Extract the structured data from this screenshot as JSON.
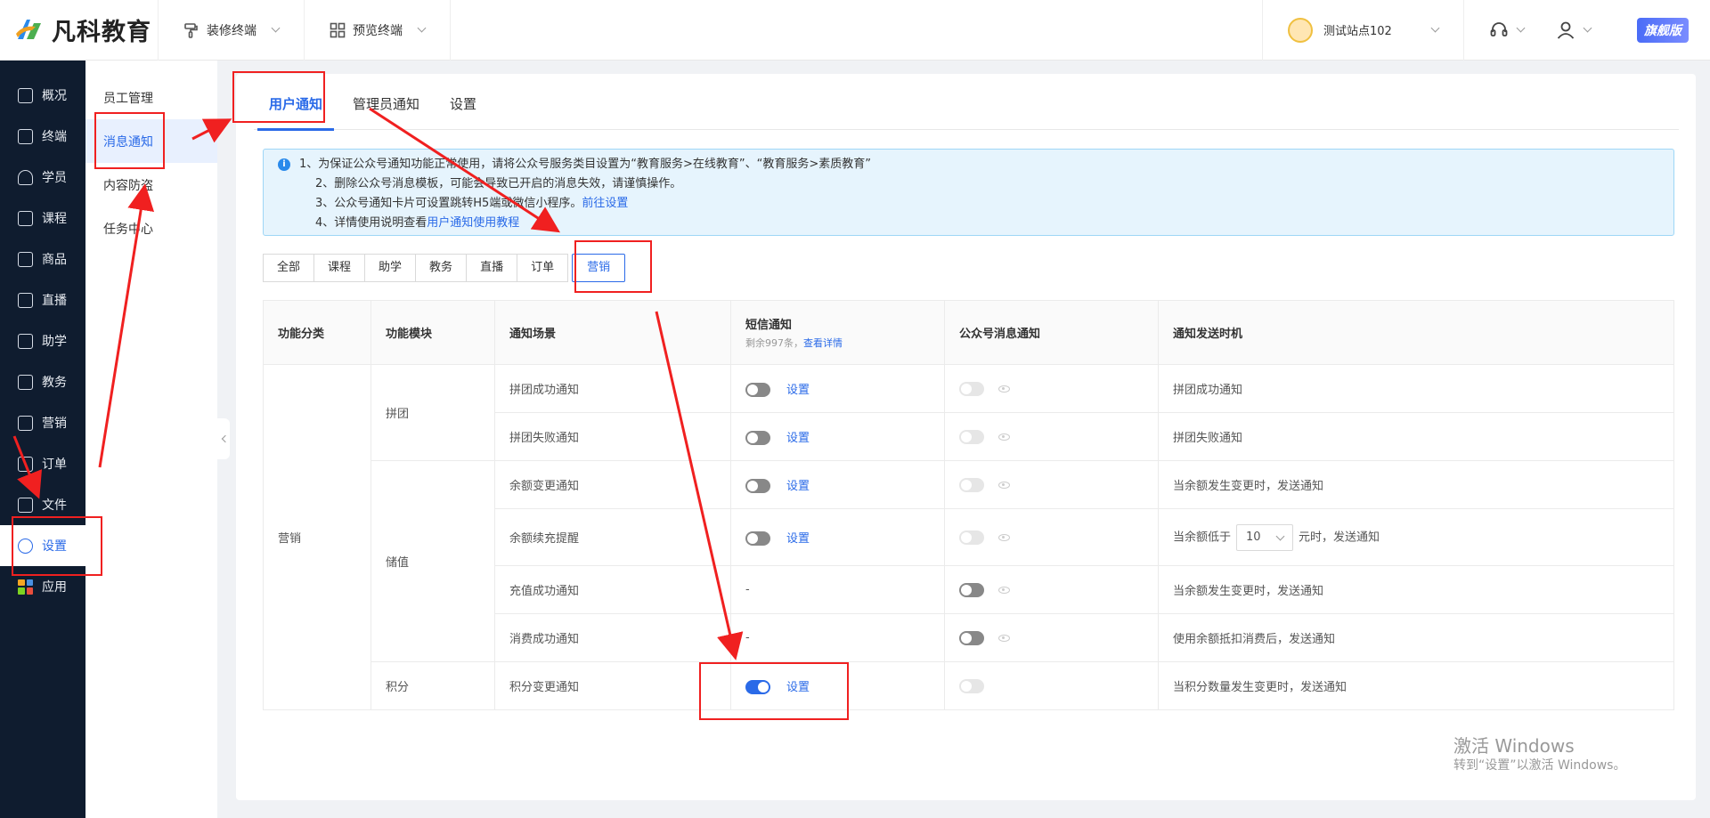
{
  "header": {
    "logo_text": "凡科教育",
    "nav": [
      {
        "label": "装修终端",
        "icon": "paint-roller-icon"
      },
      {
        "label": "预览终端",
        "icon": "grid-icon"
      }
    ],
    "site_name": "测试站点102",
    "edition_badge": "旗舰版"
  },
  "sidebar": {
    "items": [
      {
        "label": "概况",
        "icon": "grid-icon"
      },
      {
        "label": "终端",
        "icon": "store-icon"
      },
      {
        "label": "学员",
        "icon": "users-icon"
      },
      {
        "label": "课程",
        "icon": "course-icon"
      },
      {
        "label": "商品",
        "icon": "goods-icon"
      },
      {
        "label": "直播",
        "icon": "live-icon"
      },
      {
        "label": "助学",
        "icon": "assist-icon"
      },
      {
        "label": "教务",
        "icon": "book-icon"
      },
      {
        "label": "营销",
        "icon": "shop-icon"
      },
      {
        "label": "订单",
        "icon": "order-icon"
      },
      {
        "label": "文件",
        "icon": "folder-icon"
      },
      {
        "label": "设置",
        "icon": "settings-icon",
        "active": true
      },
      {
        "label": "应用",
        "icon": "apps-icon"
      }
    ]
  },
  "subnav": {
    "items": [
      {
        "label": "员工管理"
      },
      {
        "label": "消息通知",
        "active": true
      },
      {
        "label": "内容防盗"
      },
      {
        "label": "任务中心"
      }
    ]
  },
  "tabs": [
    {
      "label": "用户通知",
      "active": true
    },
    {
      "label": "管理员通知"
    },
    {
      "label": "设置"
    }
  ],
  "notice": {
    "line1": "1、为保证公众号通知功能正常使用，请将公众号服务类目设置为“教育服务>在线教育”、“教育服务>素质教育”",
    "line2": "2、删除公众号消息模板，可能会导致已开启的消息失效，请谨慎操作。",
    "line3_text": "3、公众号通知卡片可设置跳转H5端或微信小程序。",
    "line3_link": "前往设置",
    "line4_text": "4、详情使用说明查看",
    "line4_link": "用户通知使用教程"
  },
  "categories": [
    {
      "label": "全部"
    },
    {
      "label": "课程"
    },
    {
      "label": "助学"
    },
    {
      "label": "教务"
    },
    {
      "label": "直播"
    },
    {
      "label": "订单"
    },
    {
      "label": "营销",
      "active": true
    }
  ],
  "table": {
    "headers": {
      "category": "功能分类",
      "module": "功能模块",
      "scene": "通知场景",
      "sms": "短信通知",
      "sms_remaining": "剩余997条，",
      "sms_detail_link": "查看详情",
      "wechat": "公众号消息通知",
      "timing": "通知发送时机"
    },
    "category_value": "营销",
    "modules": {
      "group": "拼团",
      "balance": "储值",
      "points": "积分"
    },
    "setting_label": "设置",
    "dash": "-",
    "rows": [
      {
        "scene": "拼团成功通知",
        "sms": "off",
        "wechat": "disabled",
        "timing": "拼团成功通知"
      },
      {
        "scene": "拼团失败通知",
        "sms": "off",
        "wechat": "disabled",
        "timing": "拼团失败通知"
      },
      {
        "scene": "余额变更通知",
        "sms": "off",
        "wechat": "disabled",
        "timing": "当余额发生变更时，发送通知"
      },
      {
        "scene": "余额续充提醒",
        "sms": "off",
        "wechat": "disabled",
        "timing_prefix": "当余额低于",
        "timing_value": "10",
        "timing_suffix": "元时，发送通知"
      },
      {
        "scene": "充值成功通知",
        "sms": "none",
        "wechat": "off",
        "timing": "当余额发生变更时，发送通知"
      },
      {
        "scene": "消费成功通知",
        "sms": "none",
        "wechat": "off",
        "timing": "使用余额抵扣消费后，发送通知"
      },
      {
        "scene": "积分变更通知",
        "sms": "on",
        "wechat": "disabled",
        "timing": "当积分数量发生变更时，发送通知"
      }
    ]
  },
  "watermark": {
    "line1": "激活 Windows",
    "line2": "转到“设置”以激活 Windows。"
  }
}
